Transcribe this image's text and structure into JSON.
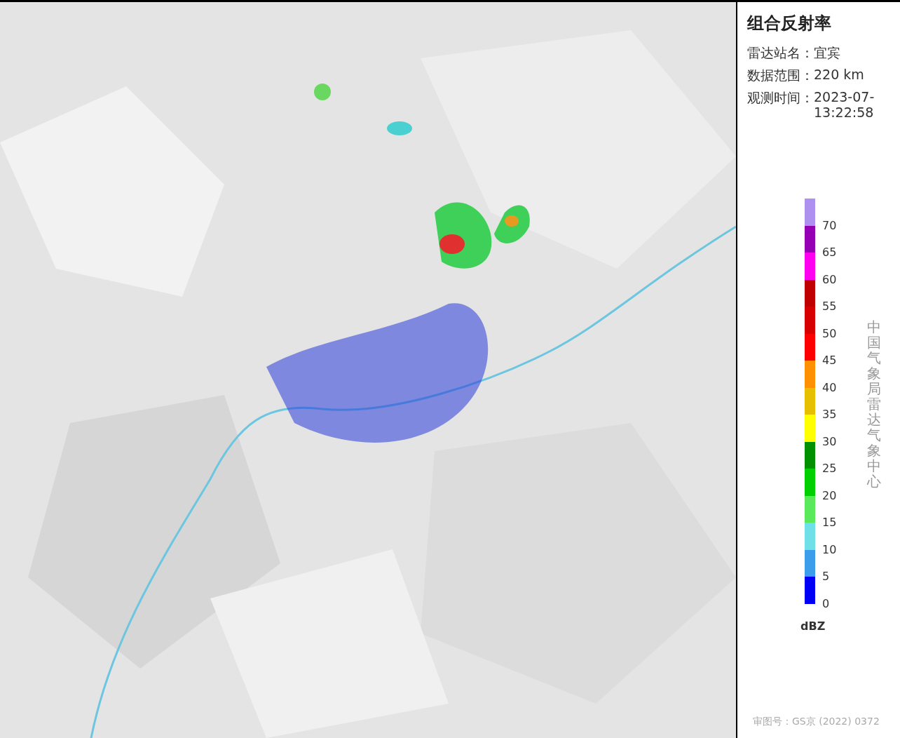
{
  "panel": {
    "title": "组合反射率",
    "info": [
      {
        "label": "雷达站名：",
        "value": "宜宾"
      },
      {
        "label": "数据范围：",
        "value": "220 km"
      },
      {
        "label": "观测时间：",
        "value": "2023-07-",
        "value_line2": "13:22:58"
      }
    ],
    "legend": {
      "unit": "dBZ",
      "items": [
        {
          "label": "70",
          "color": "#ad90f0"
        },
        {
          "label": "65",
          "color": "#9600b4"
        },
        {
          "label": "60",
          "color": "#ff00f0"
        },
        {
          "label": "55",
          "color": "#c00000"
        },
        {
          "label": "50",
          "color": "#d60000"
        },
        {
          "label": "45",
          "color": "#ff0000"
        },
        {
          "label": "40",
          "color": "#ff9000"
        },
        {
          "label": "35",
          "color": "#e6c000"
        },
        {
          "label": "30",
          "color": "#ffff00"
        },
        {
          "label": "25",
          "color": "#009000"
        },
        {
          "label": "20",
          "color": "#00d000"
        },
        {
          "label": "15",
          "color": "#5ae95a"
        },
        {
          "label": "10",
          "color": "#6fe0e8"
        },
        {
          "label": "5",
          "color": "#3c9dea"
        },
        {
          "label": "0",
          "color": "#0000f6"
        }
      ]
    },
    "credit": "中国气象局雷达气象中心",
    "footer": "审图号：GS京 (2022) 0372"
  }
}
